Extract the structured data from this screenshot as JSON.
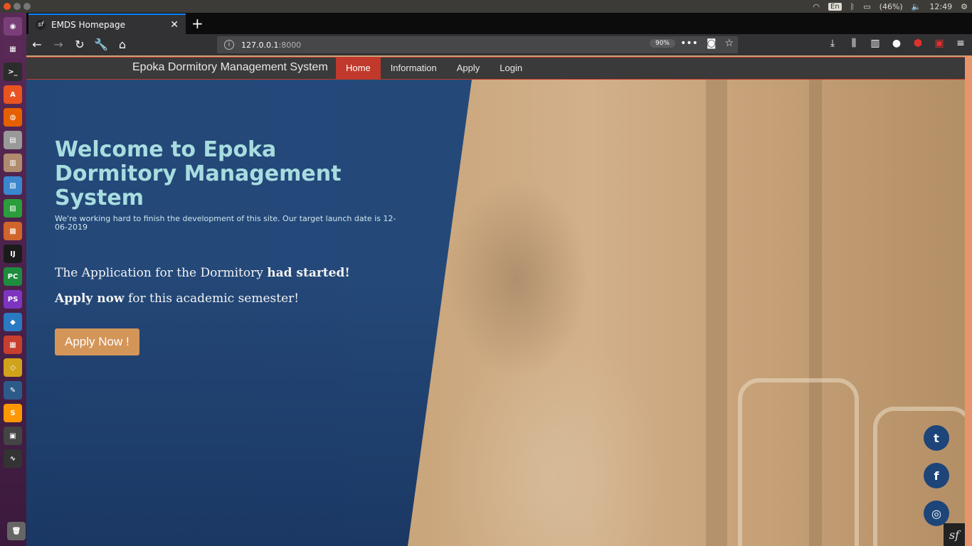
{
  "system": {
    "language": "En",
    "battery": "(46%)",
    "clock": "12:49"
  },
  "launcher": {
    "apps": [
      {
        "icon": "ubuntu-dash-icon",
        "color": "#7a3f79"
      },
      {
        "icon": "workspace-switcher-icon",
        "color": "#5a2a57"
      },
      {
        "icon": "terminal-icon",
        "color": "#2c2c2c"
      },
      {
        "icon": "software-center-icon",
        "color": "#e95420"
      },
      {
        "icon": "firefox-icon",
        "color": "#e66000"
      },
      {
        "icon": "disk-icon",
        "color": "#999999"
      },
      {
        "icon": "archive-icon",
        "color": "#b08b6e"
      },
      {
        "icon": "writer-icon",
        "color": "#3a87ce"
      },
      {
        "icon": "calc-icon",
        "color": "#2a9d3c"
      },
      {
        "icon": "impress-icon",
        "color": "#d0652c"
      },
      {
        "icon": "intellij-icon",
        "color": "#1b1b1b"
      },
      {
        "icon": "pycharm-icon",
        "color": "#1e8c3f"
      },
      {
        "icon": "phpstorm-icon",
        "color": "#7d35c0"
      },
      {
        "icon": "vscode-icon",
        "color": "#2a7ac2"
      },
      {
        "icon": "mosaic-icon",
        "color": "#c63f2e"
      },
      {
        "icon": "network-icon",
        "color": "#d1a31c"
      },
      {
        "icon": "mysql-workbench-icon",
        "color": "#2c5b8a"
      },
      {
        "icon": "sublime-icon",
        "color": "#ff9800"
      },
      {
        "icon": "remote-desktop-icon",
        "color": "#444444"
      },
      {
        "icon": "system-monitor-icon",
        "color": "#333333"
      }
    ],
    "trash_icon": "trash-icon"
  },
  "browser": {
    "tab_title": "EMDS Homepage",
    "url_host": "127.0.0.1",
    "url_port": ":8000",
    "zoom": "90%"
  },
  "site": {
    "brand": "Epoka Dormitory Management System",
    "menu": [
      {
        "label": "Home",
        "active": true
      },
      {
        "label": "Information",
        "active": false
      },
      {
        "label": "Apply",
        "active": false
      },
      {
        "label": "Login",
        "active": false
      }
    ],
    "hero": {
      "title": "Welcome to Epoka Dormitory Management System",
      "subtitle": "We're working hard to finish the development of this site. Our target launch date is 12-06-2019",
      "lead_prefix": "The Application for the Dormitory ",
      "lead_bold": "had started!",
      "lead2_bold": "Apply now",
      "lead2_suffix": " for this academic semester!",
      "button": "Apply Now !"
    },
    "social": [
      {
        "icon": "twitter-icon",
        "glyph": "t"
      },
      {
        "icon": "facebook-icon",
        "glyph": "f"
      },
      {
        "icon": "instagram-icon",
        "glyph": "◎"
      }
    ],
    "symfony_badge": "sf"
  },
  "colors": {
    "nav_active": "#c0392b",
    "hero_panel": "#1d4579",
    "button": "#d39558",
    "title": "#a8dde0"
  }
}
